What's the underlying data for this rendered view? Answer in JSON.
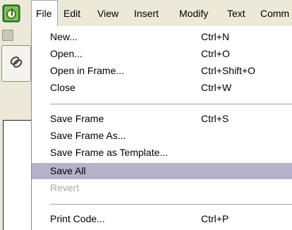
{
  "menubar": {
    "items": [
      {
        "label": "File"
      },
      {
        "label": "Edit"
      },
      {
        "label": "View"
      },
      {
        "label": "Insert"
      },
      {
        "label": "Modify"
      },
      {
        "label": "Text"
      },
      {
        "label": "Comm"
      }
    ],
    "active": "File"
  },
  "file_menu": {
    "groups": [
      [
        {
          "label": "New...",
          "shortcut": "Ctrl+N"
        },
        {
          "label": "Open...",
          "shortcut": "Ctrl+O"
        },
        {
          "label": "Open in Frame...",
          "shortcut": "Ctrl+Shift+O"
        },
        {
          "label": "Close",
          "shortcut": "Ctrl+W"
        }
      ],
      [
        {
          "label": "Save Frame",
          "shortcut": "Ctrl+S"
        },
        {
          "label": "Save Frame As...",
          "shortcut": ""
        },
        {
          "label": "Save Frame as Template...",
          "shortcut": ""
        },
        {
          "label": "Save All",
          "shortcut": "",
          "highlighted": true
        },
        {
          "label": "Revert",
          "shortcut": "",
          "disabled": true
        }
      ],
      [
        {
          "label": "Print Code...",
          "shortcut": "Ctrl+P"
        }
      ]
    ]
  },
  "icons": {
    "app": "dreamweaver-app-icon",
    "toolbar": "hyperlink-tool-icon"
  },
  "colors": {
    "menubar_bg": "#ece9d8",
    "highlight": "#b5b2c9",
    "disabled_text": "#aca899"
  }
}
